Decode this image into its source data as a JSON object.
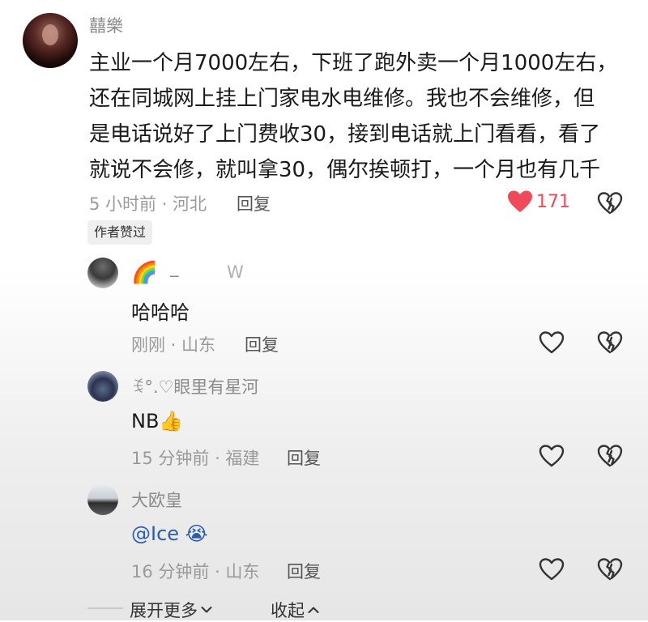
{
  "main_comment": {
    "username": "囍樂",
    "lines": [
      "主业一个月7000左右，下班了跑外卖一个月1000左右，",
      "还在同城网上挂上门家电水电维修。我也不会维修，但",
      "是电话说好了上门费收30，接到电话就上门看看，看了",
      "就说不会修，就叫拿30，偶尔挨顿打，一个月也有几千"
    ],
    "meta": "5 小时前 · 河北",
    "reply_label": "回复",
    "like_count": "171",
    "badge": "作者赞过"
  },
  "replies": [
    {
      "username_emoji": "🌈",
      "username_rest": "_",
      "username_tail": "W",
      "text": "哈哈哈",
      "meta": "刚刚 · 山东",
      "reply_label": "回复"
    },
    {
      "username": "ꉂ°.♡眼里有星河",
      "text": "NB👍",
      "meta": "15 分钟前 · 福建",
      "reply_label": "回复"
    },
    {
      "username": "大欧皇",
      "text": "@Ice 😭",
      "meta": "16 分钟前 · 山东",
      "reply_label": "回复"
    }
  ],
  "footer": {
    "expand_label": "展开更多",
    "collapse_label": "收起"
  },
  "colors": {
    "like_red": "#f04a5a",
    "meta_gray": "#9a9a9a",
    "username_gray": "#8a8a8a"
  },
  "icons": {
    "like_filled": "heart-filled-icon",
    "like_outline": "heart-outline-icon",
    "dislike": "broken-heart-icon",
    "expand": "chevron-down-icon",
    "collapse": "chevron-up-icon"
  }
}
